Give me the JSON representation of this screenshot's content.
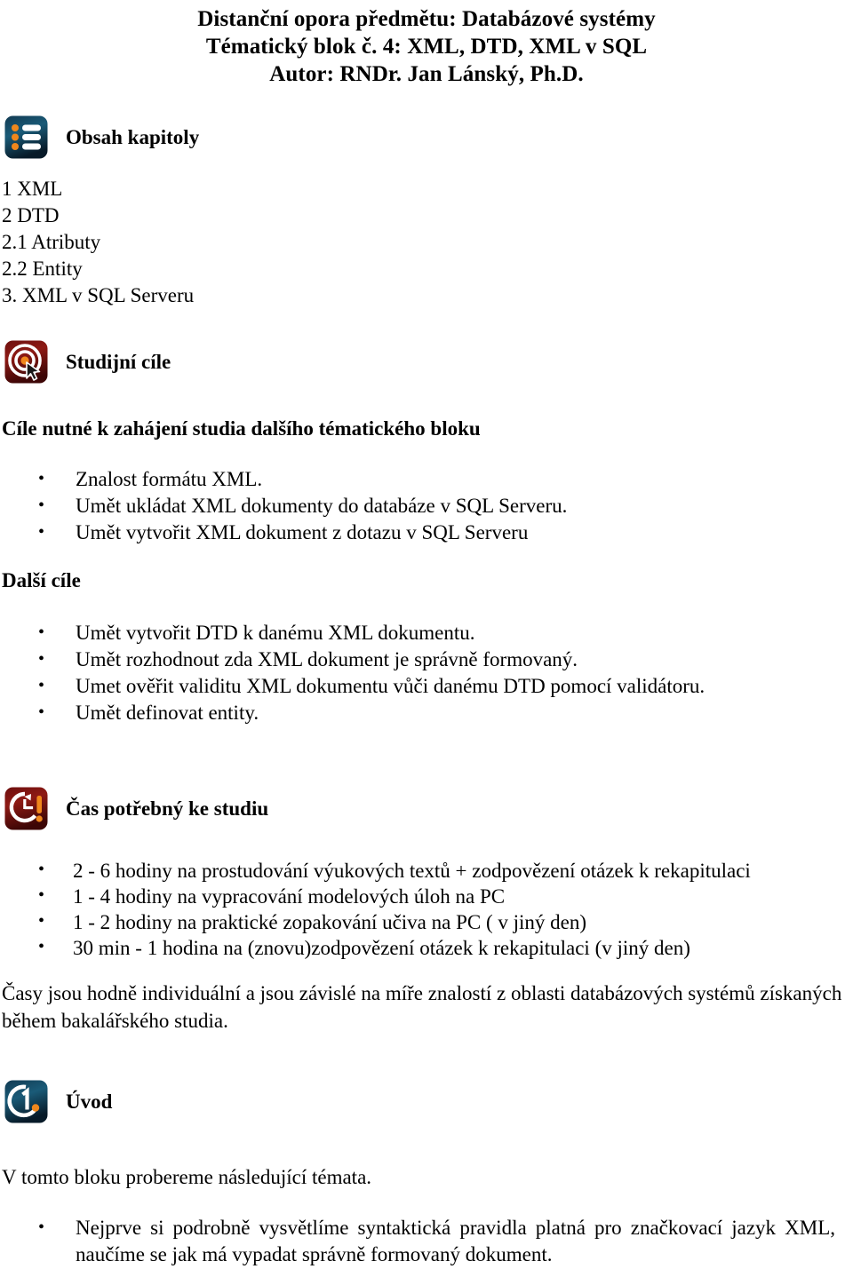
{
  "title": {
    "line1": "Distanční opora předmětu: Databázové systémy",
    "line2": "Tématický blok č. 4: XML, DTD, XML v SQL",
    "line3": "Autor: RNDr. Jan Lánský, Ph.D."
  },
  "colors": {
    "icon_blue_dark": "#0b2338",
    "icon_blue_mid": "#1d5f7e",
    "icon_red_dark": "#5a0a0a",
    "icon_red_mid": "#8e1616",
    "icon_orange": "#f08a20",
    "icon_white": "#ffffff",
    "text": "#000000",
    "page_background": "#ffffff"
  },
  "sections": {
    "toc": {
      "icon": "list-icon",
      "heading": "Obsah kapitoly",
      "items": [
        "1 XML",
        "2 DTD",
        "2.1 Atributy",
        "2.2 Entity",
        "3. XML v SQL Serveru"
      ]
    },
    "goals": {
      "icon": "target-cursor-icon",
      "heading": "Studijní cíle",
      "subheading": "Cíle nutné k zahájení studia dalšího tématického bloku",
      "items": [
        "Znalost formátu XML.",
        "Umět ukládat XML dokumenty do databáze v SQL Serveru.",
        "Umět vytvořit XML dokument z dotazu v SQL Serveru"
      ],
      "further_heading": "Další cíle",
      "further_items": [
        "Umět vytvořit DTD k danému XML dokumentu.",
        "Umět rozhodnout zda XML dokument je správně formovaný.",
        "Umet ověřit validitu XML dokumentu vůči danému DTD pomocí validátoru.",
        "Umět definovat entity."
      ]
    },
    "time": {
      "icon": "clock-alert-icon",
      "heading": "Čas potřebný ke studiu",
      "items": [
        "2 - 6 hodiny na prostudování výukových textů + zodpovězení otázek k rekapitulaci",
        "1 - 4 hodiny na vypracování modelových úloh na PC",
        "1 - 2 hodiny na praktické zopakování učiva na PC ( v jiný den)",
        "30 min - 1 hodina  na (znovu)zodpovězení otázek k rekapitulaci (v jiný den)"
      ],
      "note": "Časy jsou hodně individuální a jsou závislé na míře znalostí z oblasti databázových systémů získaných během bakalářského studia."
    },
    "intro": {
      "icon": "number-one-icon",
      "heading": "Úvod",
      "paragraph": "V tomto bloku probereme následující témata.",
      "items": [
        "Nejprve si podrobně vysvětlíme syntaktická pravidla platná pro značkovací jazyk XML, naučíme se jak má vypadat správně formovaný dokument."
      ]
    }
  }
}
